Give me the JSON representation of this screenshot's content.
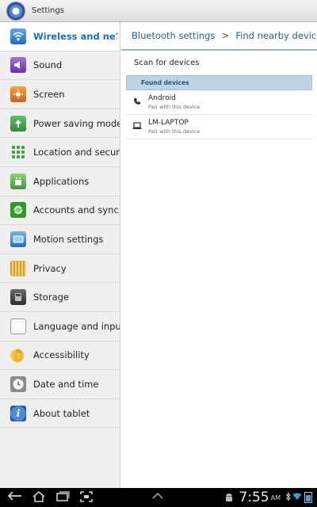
{
  "titlebar": {
    "title": "Settings",
    "icon": "settings-gear-icon"
  },
  "sidebar": {
    "items": [
      {
        "label": "Wireless and netw",
        "icon": "wifi-icon",
        "active": true
      },
      {
        "label": "Sound",
        "icon": "sound-icon"
      },
      {
        "label": "Screen",
        "icon": "screen-icon"
      },
      {
        "label": "Power saving mode",
        "icon": "power-saving-icon"
      },
      {
        "label": "Location and securit",
        "icon": "location-icon"
      },
      {
        "label": "Applications",
        "icon": "applications-icon"
      },
      {
        "label": "Accounts and sync",
        "icon": "sync-icon"
      },
      {
        "label": "Motion settings",
        "icon": "motion-icon"
      },
      {
        "label": "Privacy",
        "icon": "privacy-icon"
      },
      {
        "label": "Storage",
        "icon": "storage-icon"
      },
      {
        "label": "Language and input",
        "icon": "language-icon",
        "glyph": "A"
      },
      {
        "label": "Accessibility",
        "icon": "accessibility-hand-icon"
      },
      {
        "label": "Date and time",
        "icon": "clock-icon"
      },
      {
        "label": "About tablet",
        "icon": "info-icon",
        "glyph": "i"
      }
    ]
  },
  "main": {
    "breadcrumb": {
      "parent": "Bluetooth settings",
      "separator": ">",
      "current": "Find nearby devices"
    },
    "scan_label": "Scan for devices",
    "section_header": "Found devices",
    "devices": [
      {
        "name": "Android",
        "status": "Pair with this device",
        "icon": "phone-icon"
      },
      {
        "name": "LM-LAPTOP",
        "status": "Pair with this device",
        "icon": "laptop-icon"
      }
    ]
  },
  "statusbar": {
    "time": "7:55",
    "ampm": "AM"
  }
}
